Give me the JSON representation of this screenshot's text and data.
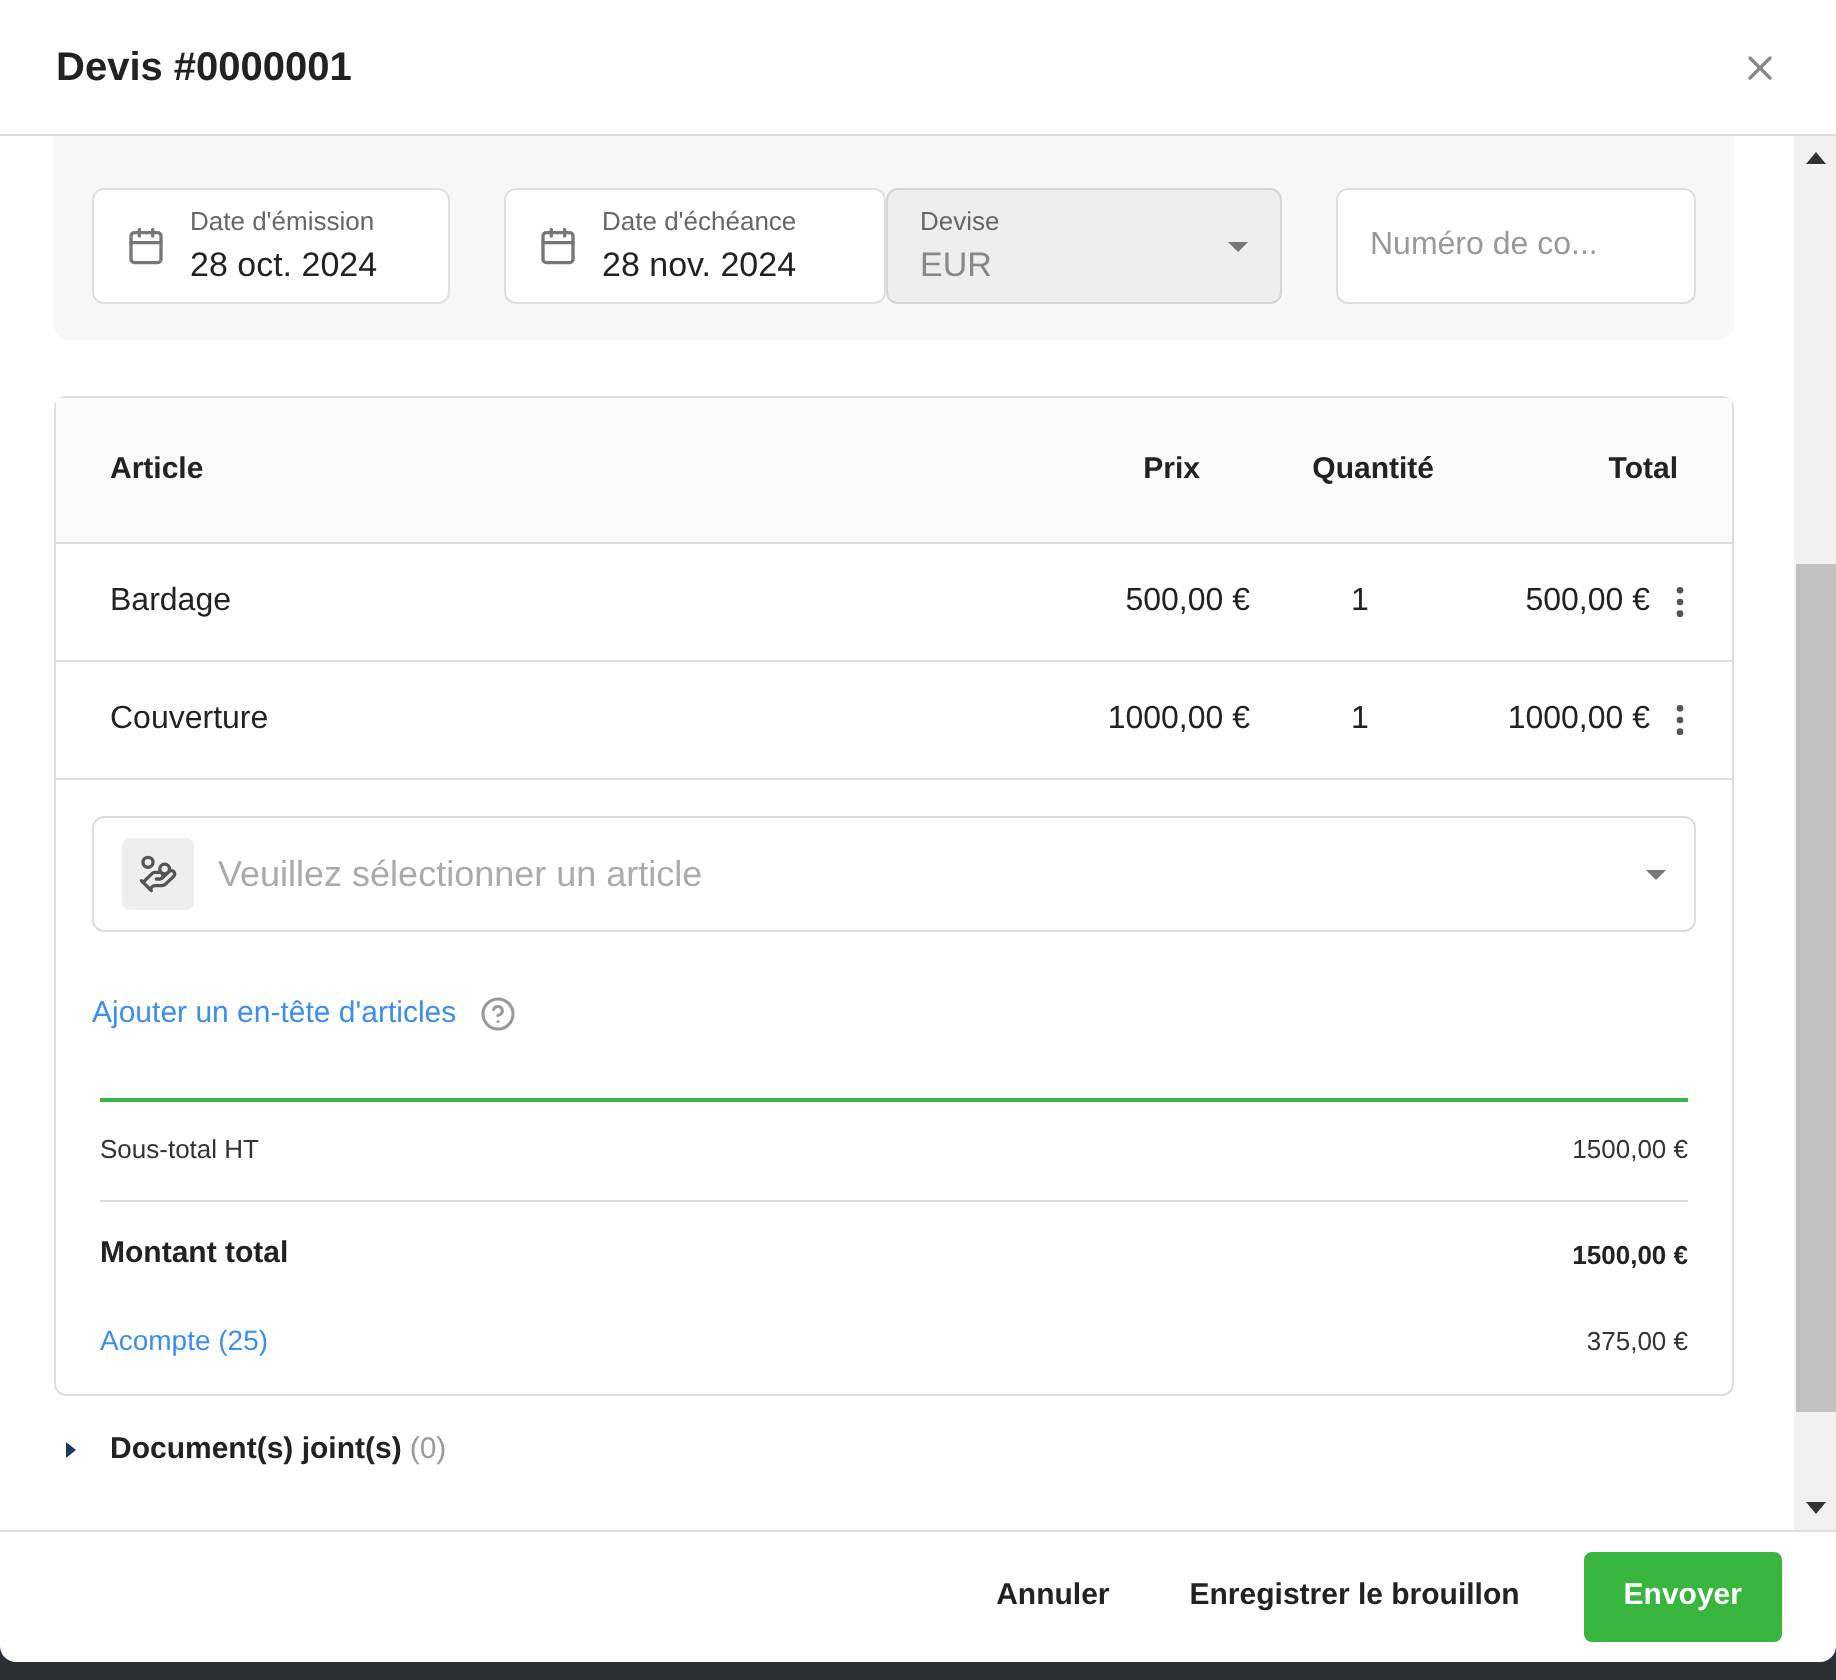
{
  "dialog": {
    "title": "Devis #0000001"
  },
  "fields": [
    {
      "kind": "date",
      "label": "Date d'émission",
      "value": "28 oct. 2024"
    },
    {
      "kind": "date",
      "label": "Date d'échéance",
      "value": "28 nov. 2024"
    },
    {
      "kind": "select",
      "label": "Devise",
      "value": "EUR",
      "disabled": true
    },
    {
      "kind": "text",
      "placeholder": "Numéro de co..."
    }
  ],
  "table": {
    "columns": [
      "Article",
      "Prix",
      "Quantité",
      "Total"
    ],
    "rows": [
      {
        "article": "Bardage",
        "price": "500,00 €",
        "quantity": "1",
        "total": "500,00 €"
      },
      {
        "article": "Couverture",
        "price": "1000,00 €",
        "quantity": "1",
        "total": "1000,00 €"
      }
    ]
  },
  "article_select": {
    "placeholder": "Veuillez sélectionner un article"
  },
  "add_header_link": "Ajouter un en-tête d'articles",
  "totals": {
    "subtotal_label": "Sous-total HT",
    "subtotal": "1500,00 €",
    "total_label": "Montant total",
    "total": "1500,00 €",
    "deposit_label": "Acompte (25)",
    "deposit": "375,00 €"
  },
  "attachments": {
    "label": "Document(s) joint(s)",
    "count": "(0)",
    "expanded": false
  },
  "buttons": {
    "cancel": "Annuler",
    "draft": "Enregistrer le brouillon",
    "send": "Envoyer"
  }
}
